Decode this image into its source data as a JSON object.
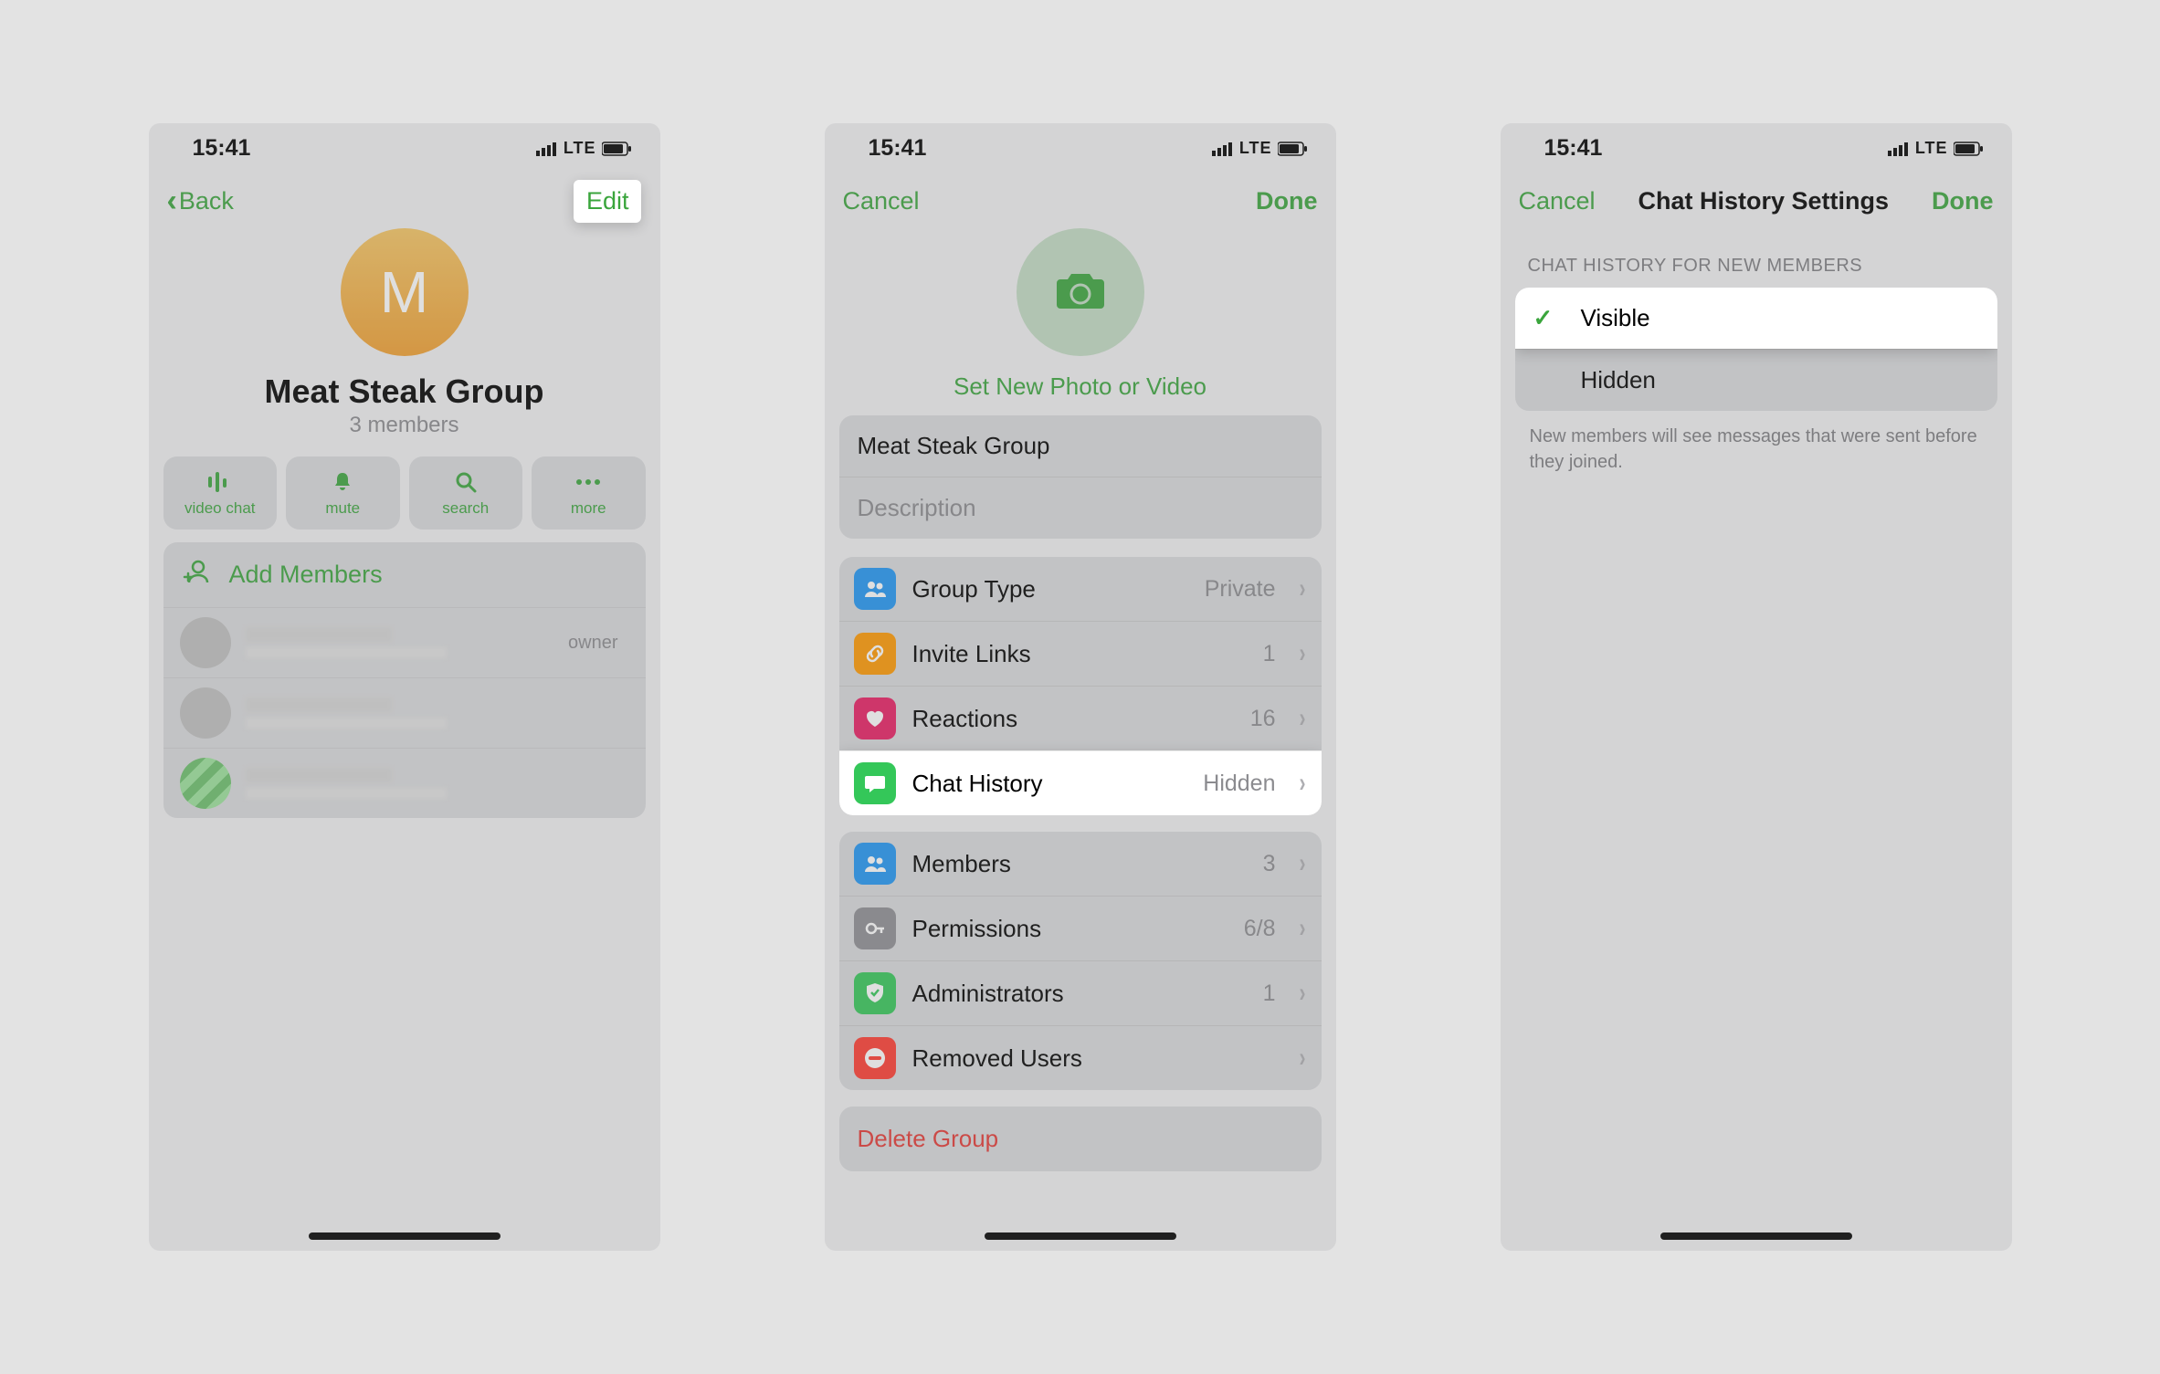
{
  "status": {
    "time": "15:41",
    "network": "LTE"
  },
  "screen1": {
    "back": "Back",
    "edit": "Edit",
    "avatarLetter": "M",
    "title": "Meat Steak Group",
    "subtitle": "3 members",
    "actions": {
      "videochat": "video chat",
      "mute": "mute",
      "search": "search",
      "more": "more"
    },
    "addMembers": "Add Members",
    "ownerTag": "owner"
  },
  "screen2": {
    "cancel": "Cancel",
    "done": "Done",
    "setPhoto": "Set New Photo or Video",
    "groupName": "Meat Steak Group",
    "descPlaceholder": "Description",
    "rowsA": [
      {
        "icon": "#2196f3",
        "glyph": "people",
        "label": "Group Type",
        "value": "Private"
      },
      {
        "icon": "#ff9800",
        "glyph": "link",
        "label": "Invite Links",
        "value": "1"
      },
      {
        "icon": "#e91e63",
        "glyph": "heart",
        "label": "Reactions",
        "value": "16"
      },
      {
        "icon": "#34c759",
        "glyph": "bubble",
        "label": "Chat History",
        "value": "Hidden",
        "hl": true
      }
    ],
    "rowsB": [
      {
        "icon": "#2196f3",
        "glyph": "people",
        "label": "Members",
        "value": "3"
      },
      {
        "icon": "#8e8e93",
        "glyph": "key",
        "label": "Permissions",
        "value": "6/8"
      },
      {
        "icon": "#34c759",
        "glyph": "shield",
        "label": "Administrators",
        "value": "1"
      },
      {
        "icon": "#ff3b30",
        "glyph": "minus",
        "label": "Removed Users",
        "value": ""
      }
    ],
    "delete": "Delete Group"
  },
  "screen3": {
    "cancel": "Cancel",
    "title": "Chat History Settings",
    "done": "Done",
    "sectionHeader": "CHAT HISTORY FOR NEW MEMBERS",
    "options": [
      {
        "label": "Visible",
        "checked": true,
        "hl": true
      },
      {
        "label": "Hidden",
        "checked": false,
        "hl": false
      }
    ],
    "footnote": "New members will see messages that were sent before they joined."
  }
}
